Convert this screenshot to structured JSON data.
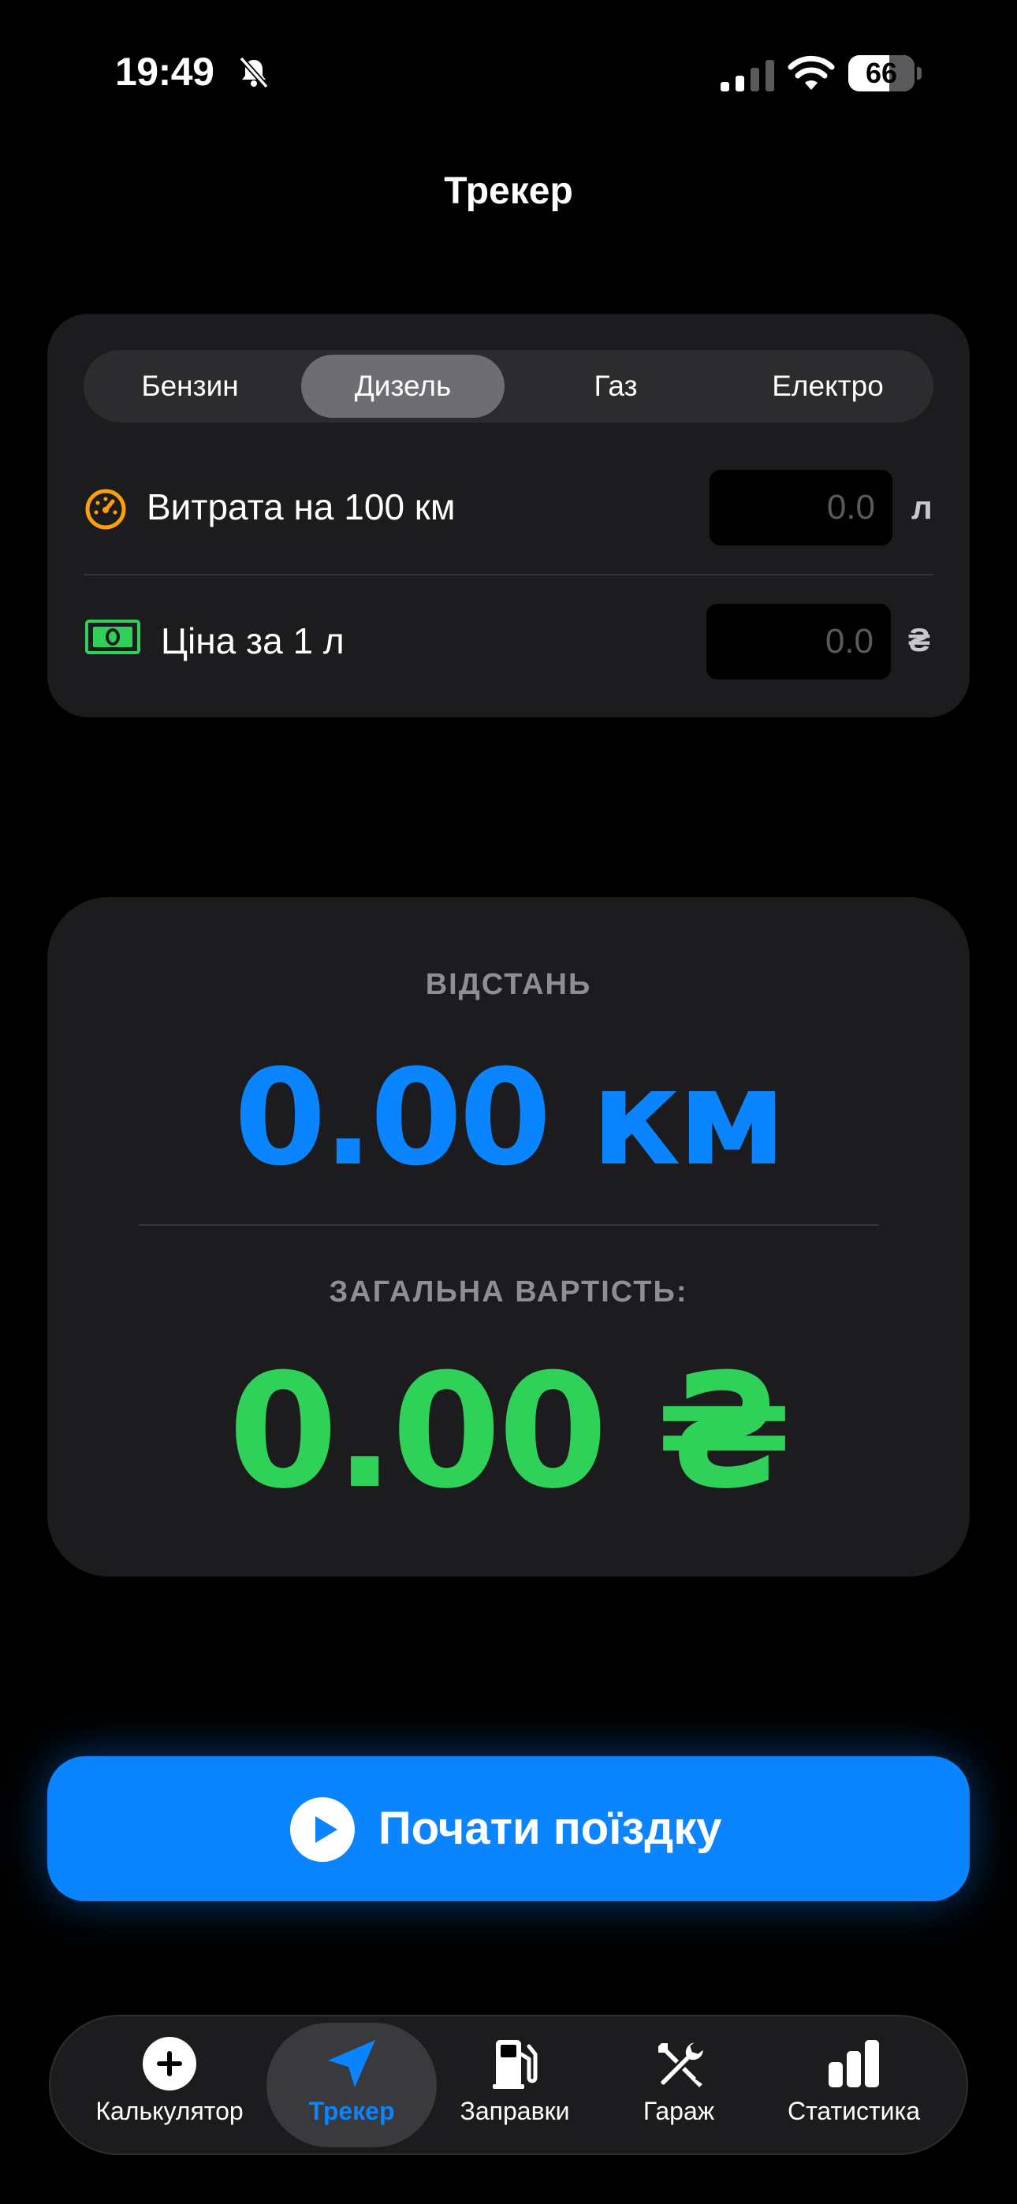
{
  "status_bar": {
    "time": "19:49",
    "battery": "66"
  },
  "header": {
    "title": "Трекер"
  },
  "fuel_tabs": [
    "Бензин",
    "Дизель",
    "Газ",
    "Електро"
  ],
  "selected_fuel": "Дизель",
  "consumption": {
    "label": "Витрата на 100 км",
    "placeholder": "0.0",
    "unit": "л"
  },
  "price": {
    "label": "Ціна за 1 л",
    "placeholder": "0.0",
    "unit": "₴"
  },
  "stats": {
    "distance_label": "ВІДСТАНЬ",
    "distance_value": "0.00 км",
    "cost_label": "ЗАГАЛЬНА ВАРТІСТЬ:",
    "cost_value": "0.00 ₴"
  },
  "start_button": {
    "label": "Почати поїздку"
  },
  "tabbar": {
    "items": [
      {
        "label": "Калькулятор",
        "icon": "plus-circle-icon"
      },
      {
        "label": "Трекер",
        "icon": "location-arrow-icon"
      },
      {
        "label": "Заправки",
        "icon": "fuel-pump-icon"
      },
      {
        "label": "Гараж",
        "icon": "wrench-screwdriver-icon"
      },
      {
        "label": "Статистика",
        "icon": "bar-chart-icon"
      }
    ],
    "active": "Трекер"
  },
  "colors": {
    "accent_blue": "#0a84ff",
    "accent_green": "#30d158",
    "card_bg": "#1c1c1e",
    "gauge_icon": "#ff9f0a"
  }
}
